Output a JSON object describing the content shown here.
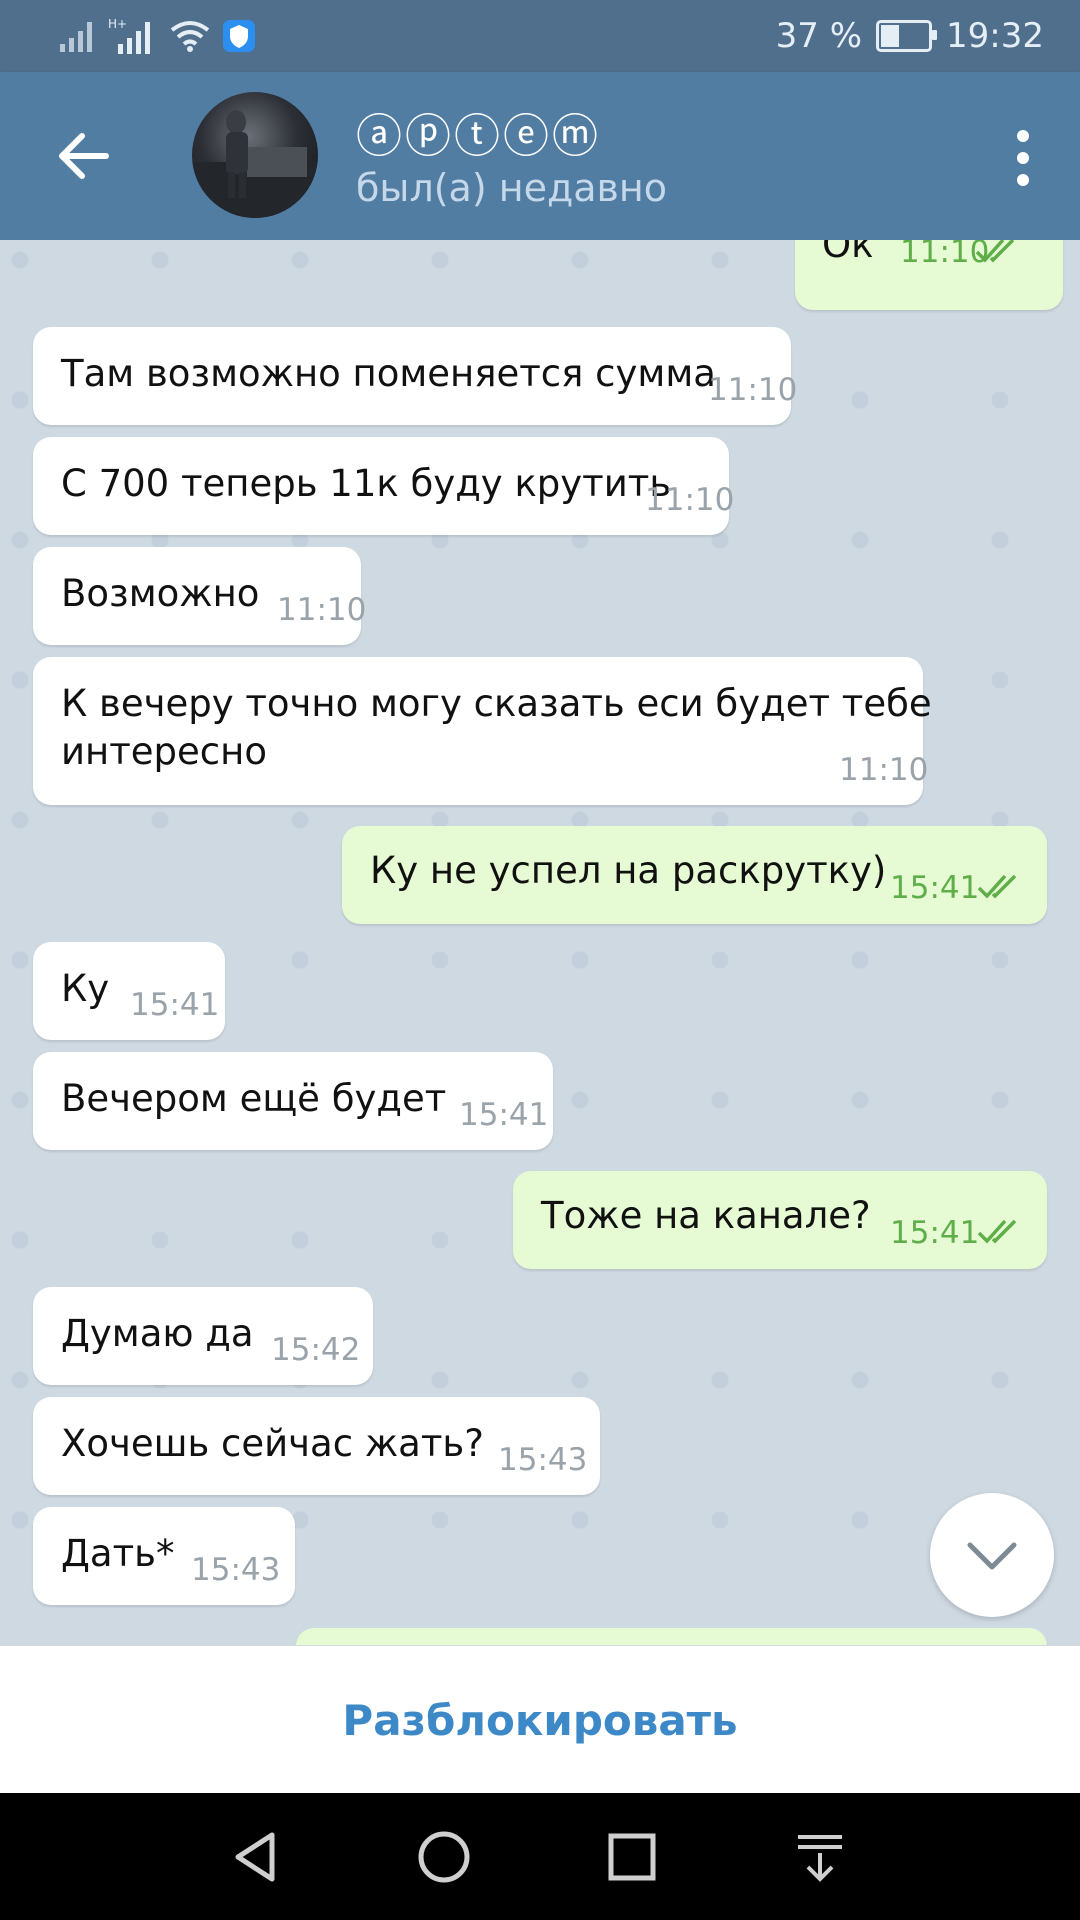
{
  "status_bar": {
    "battery_text": "37 %",
    "battery_level": 0.37,
    "time": "19:32",
    "icons": [
      "signal-icon",
      "signal-hplus-icon",
      "wifi-icon",
      "shield-app-icon",
      "battery-icon"
    ]
  },
  "header": {
    "contact_name": "ⓐⓟⓣⓔⓜ",
    "status": "был(а) недавно",
    "icons": [
      "back-arrow-icon",
      "avatar",
      "more-vert-icon"
    ]
  },
  "messages": [
    {
      "dir": "out",
      "text": "Ок",
      "time": "11:10",
      "read": true
    },
    {
      "dir": "in",
      "text": "Там возможно поменяется сумма",
      "time": "11:10"
    },
    {
      "dir": "in",
      "text": "С 700 теперь 11к буду крутить",
      "time": "11:10"
    },
    {
      "dir": "in",
      "text": "Возможно",
      "time": "11:10"
    },
    {
      "dir": "in",
      "text_line1": "К вечеру точно могу сказать еси будет тебе",
      "text_line2": "интересно",
      "time": "11:10"
    },
    {
      "dir": "out",
      "text": "Ку не успел на раскрутку)",
      "time": "15:41",
      "read": true
    },
    {
      "dir": "in",
      "text": "Ку",
      "time": "15:41"
    },
    {
      "dir": "in",
      "text": "Вечером ещё будет",
      "time": "15:41"
    },
    {
      "dir": "out",
      "text": "Тоже на канале?",
      "time": "15:41",
      "read": true
    },
    {
      "dir": "in",
      "text": "Думаю да",
      "time": "15:42"
    },
    {
      "dir": "in",
      "text": "Хочешь сейчас жать?",
      "time": "15:43"
    },
    {
      "dir": "in",
      "text": "Дать*",
      "time": "15:43"
    }
  ],
  "bottom": {
    "unblock_label": "Разблокировать"
  },
  "colors": {
    "appbar": "#527da3",
    "statusbar": "#4f6f8d",
    "outgoing_bubble": "#e6fbd3",
    "incoming_bubble": "#ffffff",
    "accent": "#3d89c8",
    "check_green": "#5fae4a"
  }
}
